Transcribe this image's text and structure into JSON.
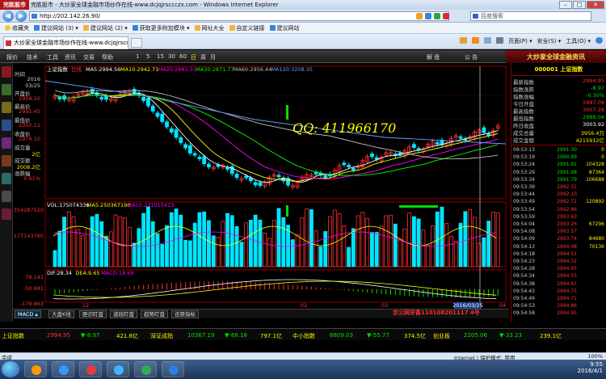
{
  "browser": {
    "brand": "完胜股市",
    "window_title": "完胜股市 - 大炒家全球金融市场炒作在线-www.dcjqjrsccczx.com - Windows Internet Explorer",
    "address": "http://202.142.26.90/",
    "search_placeholder": "百度搜索",
    "favorites": {
      "label": "收藏夹",
      "items": [
        "建议网站 (3) ▾",
        "建议网站 (2) ▾",
        "获取更多附加模块 ▾",
        "网址大全",
        "自定义链接",
        "建议网站"
      ]
    },
    "tab_title": "大炒家全球金融市场炒作在线-www.dcjqjrsccc...",
    "commands": {
      "page": "页面(P) ▾",
      "safety": "安全(S) ▾",
      "tools": "工具(O) ▾"
    },
    "status": {
      "left": "完成",
      "zone": "Internet | 保护模式: 禁用",
      "zoom": "100%"
    }
  },
  "app": {
    "menu": [
      "报价",
      "技术",
      "工具",
      "资讯",
      "交易",
      "帮助"
    ],
    "periods": [
      "1",
      "5",
      "15",
      "30",
      "60",
      "日",
      "周",
      "月"
    ],
    "center_buttons": [
      "解 盘",
      "公 告"
    ],
    "logo": "大炒家全球金融资讯",
    "sidebar": {
      "colors": [
        "#8a1a1a",
        "#3b6d2a",
        "#7a6a1a",
        "#2a4f8a",
        "#6a2a7a",
        "#7a3a1a",
        "#2a6a6a",
        "#4a4a4a",
        "#6a1a3a"
      ]
    },
    "info": {
      "labels": {
        "time": "时间",
        "open": "开盘价",
        "high": "最高价",
        "low": "最低价",
        "close": "收盘价",
        "volume": "成交量",
        "amount": "成交额",
        "change": "涨跌幅"
      },
      "values": {
        "year": "2016",
        "date": "03/25",
        "open": "2958.20",
        "high": "2991.45",
        "low": "2952.11",
        "close": "2979.10",
        "volume": "2亿",
        "amount": "2008.2亿",
        "change": "0.61%"
      }
    },
    "main_chart": {
      "name": "上证指数",
      "period": "日线",
      "ma": [
        {
          "label": "MA5:2994.56",
          "color": "#ffffff"
        },
        {
          "label": "MA10:2942.71",
          "color": "#ffff00"
        },
        {
          "label": "MA20:2881.31",
          "color": "#ff00ff"
        },
        {
          "label": "MA30:2871.77",
          "color": "#00ff00"
        },
        {
          "label": "MA60:2956.44",
          "color": "#c0c0c0"
        },
        {
          "label": "MA120:3208.35",
          "color": "#60a0ff"
        }
      ],
      "y_ticks": []
    },
    "vol_chart": {
      "labels": [
        {
          "text": "VOL:175074336",
          "color": "#ffffff"
        },
        {
          "text": "MA5:250367190",
          "color": "#ffff00"
        },
        {
          "text": "MA10:231015413",
          "color": "#ff00ff"
        }
      ],
      "y_ticks": [
        "354287520",
        "177143760"
      ]
    },
    "macd_chart": {
      "labels": [
        {
          "text": "DIF:28.34",
          "color": "#ffffff"
        },
        {
          "text": "DEA:9.65",
          "color": "#ffff00"
        },
        {
          "text": "MACD:18.69",
          "color": "#ff00ff"
        }
      ],
      "y_ticks": [
        "78.141",
        "-50.681",
        "-179.863"
      ]
    },
    "x_labels": [
      "12",
      "02",
      "03",
      "04"
    ],
    "cursor_date": "2016/03/25",
    "overlay": {
      "qq": "QQ: 411966170"
    },
    "bottom_tabs": [
      "MACD ▴",
      "大盘K线",
      "胆识盯盘",
      "波段盯盘",
      "趋势盯盘",
      "还原指标"
    ],
    "bottom_notice": "京公网安备110108201117 4号",
    "bottom_extra": "创业板",
    "right_panel": {
      "title": "000001 上证指数",
      "rows": [
        {
          "label": "最新指数",
          "value": "2994.95",
          "color": "#ff3030"
        },
        {
          "label": "指数涨跌",
          "value": "-8.97",
          "color": "#00e000"
        },
        {
          "label": "指数涨幅",
          "value": "-0.30%",
          "color": "#00e000"
        },
        {
          "label": "今日开盘",
          "value": "2997.09",
          "color": "#ff3030"
        },
        {
          "label": "最高指数",
          "value": "3007.28",
          "color": "#ff3030"
        },
        {
          "label": "最低指数",
          "value": "2989.04",
          "color": "#00e000"
        },
        {
          "label": "昨日收盘",
          "value": "3003.92",
          "color": "#ffffff"
        },
        {
          "label": "成交总量",
          "value": "3956.4万",
          "color": "#ffef00"
        },
        {
          "label": "成交金额",
          "value": "4215912亿",
          "color": "#ffef00"
        }
      ],
      "ticks": [
        {
          "t": "09:53:13",
          "p": "2991.30",
          "q": "0",
          "c": "#00e000"
        },
        {
          "t": "09:53:19",
          "p": "2990.99",
          "q": "0",
          "c": "#00e000"
        },
        {
          "t": "09:53:24",
          "p": "2991.91",
          "q": "104328",
          "c": "#00e000"
        },
        {
          "t": "09:53:29",
          "p": "2991.98",
          "q": "87364",
          "c": "#00e000"
        },
        {
          "t": "09:53:34",
          "p": "2991.79",
          "q": "106688",
          "c": "#00e000"
        },
        {
          "t": "09:53:39",
          "p": "2992.31",
          "q": "",
          "c": "#ff3030"
        },
        {
          "t": "09:53:44",
          "p": "2992.10",
          "q": "",
          "c": "#ff3030"
        },
        {
          "t": "09:53:49",
          "p": "2992.72",
          "q": "120892",
          "c": "#ff3030"
        },
        {
          "t": "09:53:54",
          "p": "2992.86",
          "q": "",
          "c": "#ff3030"
        },
        {
          "t": "09:53:59",
          "p": "2993.63",
          "q": "",
          "c": "#ff3030"
        },
        {
          "t": "09:54:04",
          "p": "2993.26",
          "q": "67296",
          "c": "#ff3030"
        },
        {
          "t": "09:54:08",
          "p": "2993.57",
          "q": "",
          "c": "#ff3030"
        },
        {
          "t": "09:54:09",
          "p": "2993.74",
          "q": "84680",
          "c": "#ff3030"
        },
        {
          "t": "09:54:13",
          "p": "2994.08",
          "q": "70136",
          "c": "#ff3030"
        },
        {
          "t": "09:54:18",
          "p": "2994.11",
          "q": "",
          "c": "#ff3030"
        },
        {
          "t": "09:54:23",
          "p": "2994.32",
          "q": "",
          "c": "#ff3030"
        },
        {
          "t": "09:54:28",
          "p": "2994.45",
          "q": "",
          "c": "#ff3030"
        },
        {
          "t": "09:54:34",
          "p": "2994.55",
          "q": "",
          "c": "#ff3030"
        },
        {
          "t": "09:54:38",
          "p": "2994.67",
          "q": "",
          "c": "#ff3030"
        },
        {
          "t": "09:54:43",
          "p": "2994.75",
          "q": "",
          "c": "#ff3030"
        },
        {
          "t": "09:54:49",
          "p": "2994.71",
          "q": "",
          "c": "#ff3030"
        },
        {
          "t": "09:54:53",
          "p": "2994.86",
          "q": "",
          "c": "#ff3030"
        },
        {
          "t": "09:54:58",
          "p": "2994.95",
          "q": "",
          "c": "#ff3030"
        }
      ]
    },
    "quotebar": [
      {
        "text": "上证指数",
        "color": "#ffef00"
      },
      {
        "text": "2994.95",
        "color": "#ff3030"
      },
      {
        "text": "▼-8.97",
        "color": "#00e000"
      },
      {
        "text": "421.6亿",
        "color": "#ffef00"
      },
      {
        "text": "深证成指",
        "color": "#ffef00"
      },
      {
        "text": "10367.19",
        "color": "#00e000"
      },
      {
        "text": "▼-88.18",
        "color": "#00e000"
      },
      {
        "text": "797.1亿",
        "color": "#ffef00"
      },
      {
        "text": "中小指数",
        "color": "#ffef00"
      },
      {
        "text": "6809.03",
        "color": "#00e000"
      },
      {
        "text": "▼-55.77",
        "color": "#00e000"
      },
      {
        "text": "374.5亿",
        "color": "#ffef00"
      },
      {
        "text": "创业板",
        "color": "#ffef00"
      },
      {
        "text": "2205.06",
        "color": "#00e000"
      },
      {
        "text": "▼-33.23",
        "color": "#00e000"
      },
      {
        "text": "239.1亿",
        "color": "#ffef00"
      }
    ]
  },
  "taskbar": {
    "time": "9:55",
    "date": "2016/4/1",
    "app_colors": [
      "#ff9900",
      "#3399ff",
      "#e23b3b",
      "#3fb6ff",
      "#33aa55",
      "#2a7de1"
    ]
  }
}
